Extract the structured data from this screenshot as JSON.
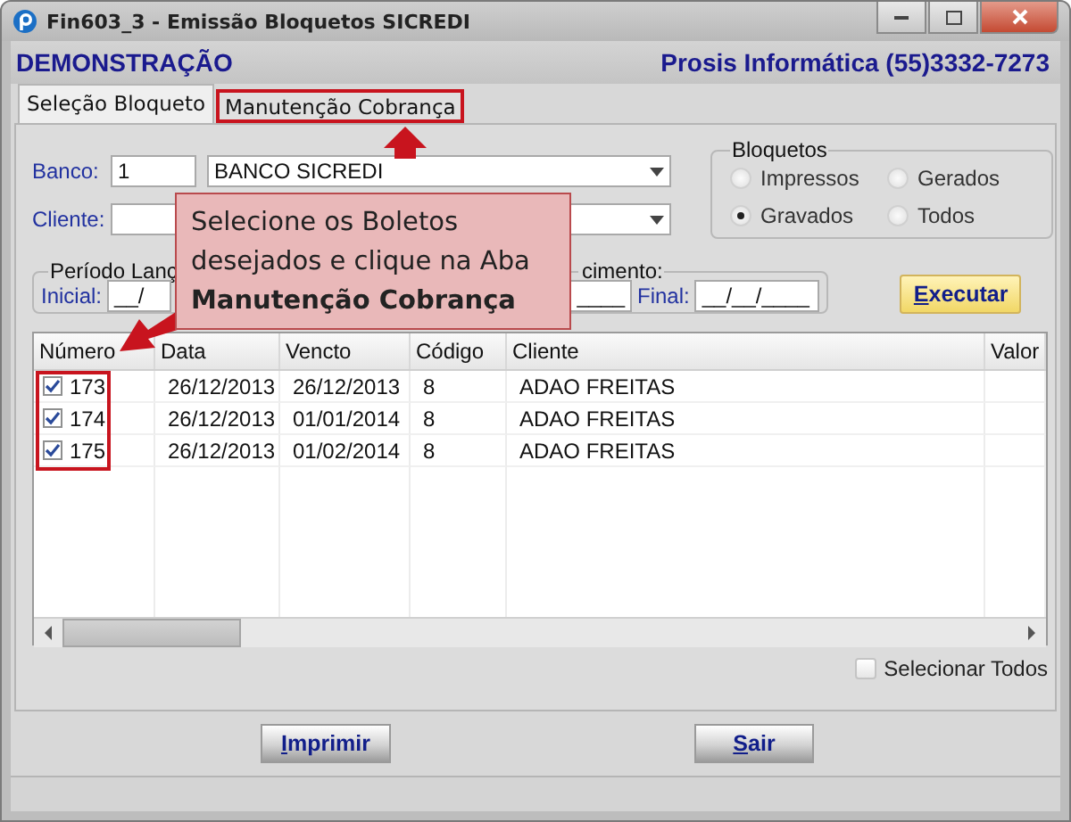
{
  "window": {
    "title": "Fin603_3 - Emissão Bloquetos SICREDI"
  },
  "header": {
    "company": "DEMONSTRAÇÃO",
    "contact": "Prosis Informática (55)3332-7273"
  },
  "tabs": [
    {
      "label": "Seleção Bloqueto",
      "selected": true,
      "highlighted": false
    },
    {
      "label": "Manutenção Cobrança",
      "selected": false,
      "highlighted": true
    }
  ],
  "form": {
    "banco_label": "Banco:",
    "banco_code": "1",
    "banco_name": "BANCO SICREDI",
    "cliente_label": "Cliente:"
  },
  "bloquetos": {
    "title": "Bloquetos",
    "options": [
      {
        "label": "Impressos",
        "selected": false
      },
      {
        "label": "Gerados",
        "selected": false
      },
      {
        "label": "Gravados",
        "selected": true
      },
      {
        "label": "Todos",
        "selected": false
      }
    ]
  },
  "periods": [
    {
      "title": "Período Lanç",
      "fields": [
        {
          "label": "Inicial:",
          "value": "__/"
        }
      ]
    },
    {
      "title": "cimento:",
      "fields": [
        {
          "value": "____"
        },
        {
          "label": "Final:",
          "value": "__/__/____"
        }
      ]
    }
  ],
  "execute_button": "Executar",
  "table": {
    "numbers_highlighted": true,
    "columns": [
      "Número",
      "Data",
      "Vencto",
      "Código",
      "Cliente",
      "Valor"
    ],
    "rows": [
      {
        "checked": true,
        "cells": [
          "173",
          "26/12/2013",
          "26/12/2013",
          "8",
          "ADAO FREITAS",
          ""
        ]
      },
      {
        "checked": true,
        "cells": [
          "174",
          "26/12/2013",
          "01/01/2014",
          "8",
          "ADAO FREITAS",
          ""
        ]
      },
      {
        "checked": true,
        "cells": [
          "175",
          "26/12/2013",
          "01/02/2014",
          "8",
          "ADAO FREITAS",
          ""
        ]
      }
    ]
  },
  "select_all": {
    "label": "Selecionar Todos",
    "checked": false
  },
  "buttons": [
    "Imprimir",
    "Sair"
  ],
  "callout": {
    "text": "Selecione os Boletos desejados e clique na Aba **Manutenção Cobrança**"
  }
}
